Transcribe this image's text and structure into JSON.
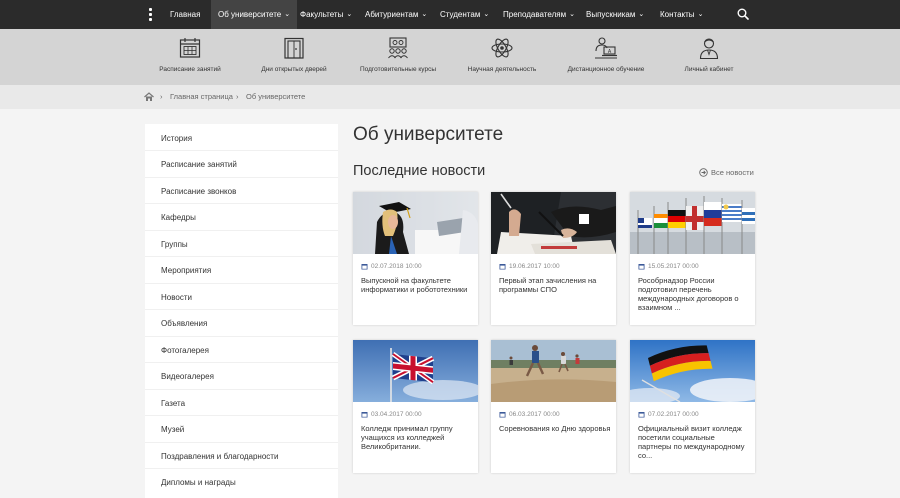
{
  "nav": {
    "items": [
      {
        "label": "Главная",
        "dropdown": false
      },
      {
        "label": "Об университете",
        "dropdown": true
      },
      {
        "label": "Факультеты",
        "dropdown": true
      },
      {
        "label": "Абитуриентам",
        "dropdown": true
      },
      {
        "label": "Студентам",
        "dropdown": true
      },
      {
        "label": "Преподавателям",
        "dropdown": true
      },
      {
        "label": "Выпускникам",
        "dropdown": true
      },
      {
        "label": "Контакты",
        "dropdown": true
      }
    ]
  },
  "quick_links": [
    {
      "label": "Расписание занятий",
      "icon": "calendar-icon"
    },
    {
      "label": "Дни открытых дверей",
      "icon": "door-icon"
    },
    {
      "label": "Подготовительные курсы",
      "icon": "courses-icon"
    },
    {
      "label": "Научная деятельность",
      "icon": "atom-icon"
    },
    {
      "label": "Дистанционное обучение",
      "icon": "distance-learning-icon"
    },
    {
      "label": "Личный кабинет",
      "icon": "user-icon"
    }
  ],
  "breadcrumb": {
    "home": "Главная страница",
    "current": "Об университете"
  },
  "sidebar": {
    "items": [
      "История",
      "Расписание занятий",
      "Расписание звонков",
      "Кафедры",
      "Группы",
      "Мероприятия",
      "Новости",
      "Объявления",
      "Фотогалерея",
      "Видеогалерея",
      "Газета",
      "Музей",
      "Поздравления и благодарности",
      "Дипломы и награды"
    ]
  },
  "main": {
    "title": "Об университете",
    "news_title": "Последние новости",
    "all_news": "Все новости"
  },
  "news": [
    {
      "date": "02.07.2018 10:00",
      "title": "Выпускной на факультете информатики и робототехники",
      "image": "graduation"
    },
    {
      "date": "19.06.2017 10:00",
      "title": "Первый этап зачисления на программы СПО",
      "image": "signing"
    },
    {
      "date": "15.05.2017 00:00",
      "title": "Рособрнадзор России подготовил перечень международных договоров о взаимном ...",
      "image": "flags"
    },
    {
      "date": "03.04.2017 00:00",
      "title": "Колледж принимал группу учащихся из колледжей Великобритании.",
      "image": "uk-flag"
    },
    {
      "date": "06.03.2017 00:00",
      "title": "Соревнования ко Дню здоровья",
      "image": "runners"
    },
    {
      "date": "07.02.2017 00:00",
      "title": "Официальный визит колледж посетили социальные партнеры по международному со...",
      "image": "german-flag"
    }
  ],
  "colors": {
    "nav_bg": "#2b2b2b",
    "quick_bg": "#d4d4d4",
    "crumb_bg": "#e9e9e9",
    "page_bg": "#f4f4f4"
  }
}
